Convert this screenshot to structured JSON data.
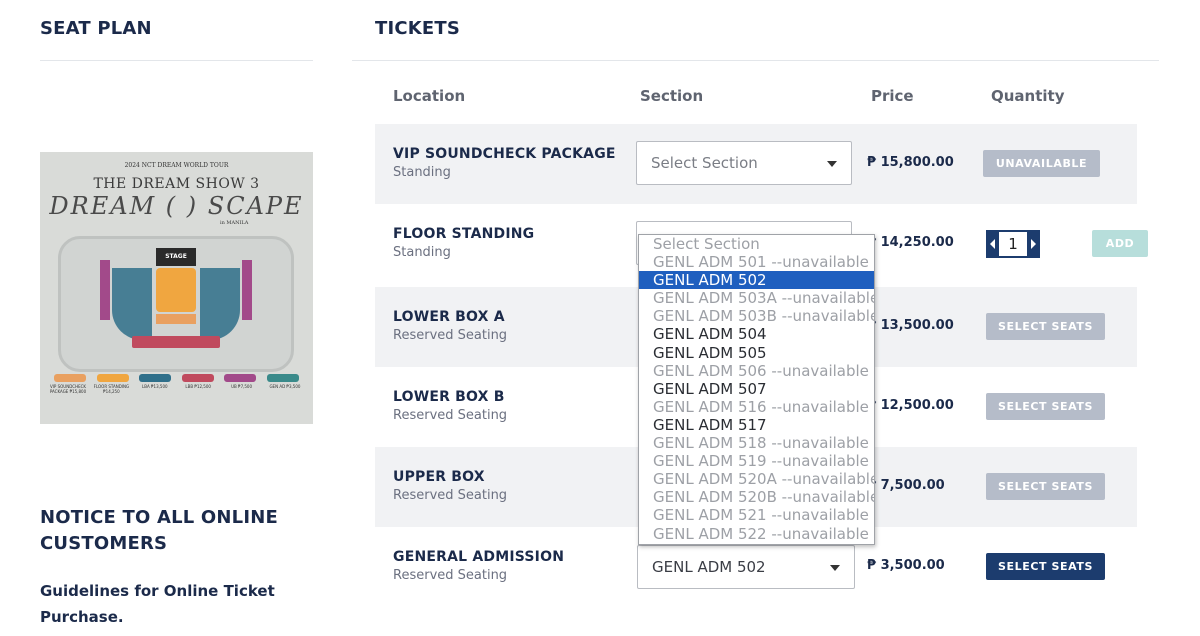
{
  "seat_plan": {
    "heading": "SEAT PLAN",
    "poster": {
      "tour_line": "2024 NCT DREAM WORLD TOUR",
      "title_line1": "THE DREAM SHOW 3",
      "title_line2": "DREAM ( ) SCAPE",
      "city": "in MANILA",
      "stage_label": "STAGE",
      "legend": [
        {
          "label": "VIP SOUNDCHECK PACKAGE ₱15,800",
          "color": "#e9a060"
        },
        {
          "label": "FLOOR STANDING ₱14,250",
          "color": "#f0a640"
        },
        {
          "label": "LBA ₱13,500",
          "color": "#2f6f8a"
        },
        {
          "label": "LBB ₱12,500",
          "color": "#c04a5e"
        },
        {
          "label": "UB ₱7,500",
          "color": "#a24a8a"
        },
        {
          "label": "GEN AD ₱3,500",
          "color": "#3a8a8a"
        }
      ]
    }
  },
  "notice": {
    "heading": "NOTICE TO ALL ONLINE CUSTOMERS",
    "guidelines": "Guidelines for Online Ticket Purchase."
  },
  "tickets": {
    "heading": "TICKETS",
    "columns": {
      "location": "Location",
      "section": "Section",
      "price": "Price",
      "quantity": "Quantity"
    },
    "rows": [
      {
        "name": "VIP SOUNDCHECK PACKAGE",
        "type": "Standing",
        "section": "Select Section",
        "price": "₱ 15,800.00",
        "action": "UNAVAILABLE"
      },
      {
        "name": "FLOOR STANDING",
        "type": "Standing",
        "section": "",
        "price": "₱ 14,250.00",
        "quantity": "1",
        "action": "ADD"
      },
      {
        "name": "LOWER BOX A",
        "type": "Reserved Seating",
        "section": "",
        "price": "₱ 13,500.00",
        "action": "SELECT SEATS"
      },
      {
        "name": "LOWER BOX B",
        "type": "Reserved Seating",
        "section": "",
        "price": "₱ 12,500.00",
        "action": "SELECT SEATS"
      },
      {
        "name": "UPPER BOX",
        "type": "Reserved Seating",
        "section": "",
        "price": "₱ 7,500.00",
        "action": "SELECT SEATS"
      },
      {
        "name": "GENERAL ADMISSION",
        "type": "Reserved Seating",
        "section": "GENL ADM 502",
        "price": "₱ 3,500.00",
        "action": "SELECT SEATS"
      }
    ],
    "dropdown_options": [
      {
        "label": "Select Section",
        "state": "disabled"
      },
      {
        "label": "GENL ADM 501 --unavailable",
        "state": "disabled"
      },
      {
        "label": "GENL ADM 502",
        "state": "selected"
      },
      {
        "label": "GENL ADM 503A --unavailable",
        "state": "disabled"
      },
      {
        "label": "GENL ADM 503B --unavailable",
        "state": "disabled"
      },
      {
        "label": "GENL ADM 504",
        "state": "enabled"
      },
      {
        "label": "GENL ADM 505",
        "state": "enabled"
      },
      {
        "label": "GENL ADM 506 --unavailable",
        "state": "disabled"
      },
      {
        "label": "GENL ADM 507",
        "state": "enabled"
      },
      {
        "label": "GENL ADM 516 --unavailable",
        "state": "disabled"
      },
      {
        "label": "GENL ADM 517",
        "state": "enabled"
      },
      {
        "label": "GENL ADM 518 --unavailable",
        "state": "disabled"
      },
      {
        "label": "GENL ADM 519 --unavailable",
        "state": "disabled"
      },
      {
        "label": "GENL ADM 520A --unavailable",
        "state": "disabled"
      },
      {
        "label": "GENL ADM 520B --unavailable",
        "state": "disabled"
      },
      {
        "label": "GENL ADM 521 --unavailable",
        "state": "disabled"
      },
      {
        "label": "GENL ADM 522 --unavailable",
        "state": "disabled"
      }
    ]
  },
  "colors": {
    "navy": "#1c3c6e",
    "disabled_button": "#b5bcc9",
    "add_button": "#b7dedb",
    "row_shade": "#f1f2f4",
    "selected_option": "#1f5fbf"
  }
}
